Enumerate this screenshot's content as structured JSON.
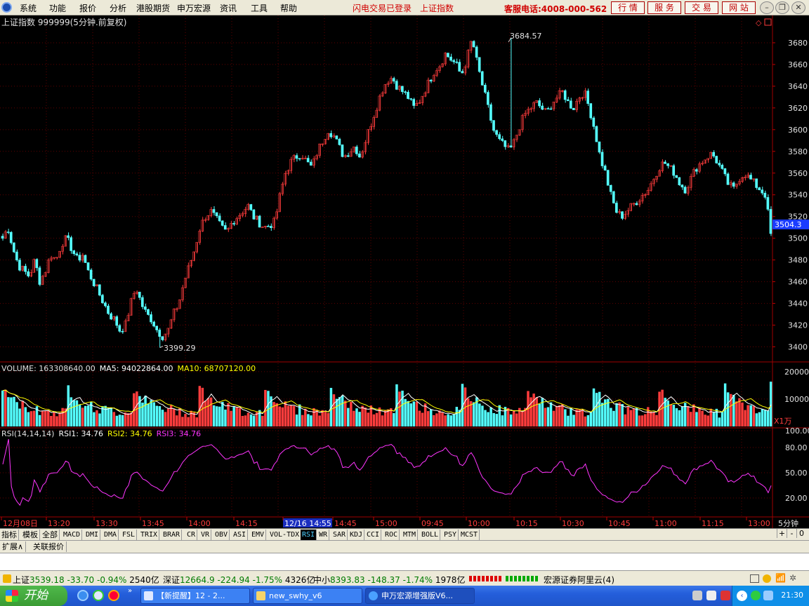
{
  "menu": {
    "items": [
      "系统",
      "功能",
      "报价",
      "分析",
      "港股期货",
      "申万宏源",
      "资讯",
      "工具",
      "帮助"
    ],
    "flash_login": "闪电交易已登录",
    "index_label": "上证指数",
    "hotline": "客服电话:4008-000-562",
    "nav_buttons": [
      "行 情",
      "服 务",
      "交 易",
      "网 站"
    ]
  },
  "chart": {
    "title": "上证指数 999999(5分钟.前复权)",
    "current_price_tag": "3504.3",
    "high_label": "3684.57",
    "low_label": "3399.29",
    "price_ticks": [
      "3680",
      "3660",
      "3640",
      "3620",
      "3600",
      "3580",
      "3560",
      "3540",
      "3520",
      "3500",
      "3480",
      "3460",
      "3440",
      "3420",
      "3400"
    ],
    "volume": {
      "label_prefix": "VOLUME: 163308640.00",
      "ma5": "MA5: 94022864.00",
      "ma10": "MA10: 68707120.00",
      "ticks": [
        "20000",
        "10000"
      ],
      "unit": "X1万"
    },
    "rsi": {
      "label": "RSI(14,14,14)",
      "rsi1": "RSI1: 34.76",
      "rsi2": "RSI2: 34.76",
      "rsi3": "RSI3: 34.76",
      "ticks": [
        "100.00",
        "80.00",
        "50.00",
        "20.00"
      ]
    },
    "time_axis": [
      "12月08日",
      "13:20",
      "13:30",
      "13:45",
      "14:00",
      "14:15",
      "12/16 14:55",
      "14:45",
      "15:00",
      "09:45",
      "10:00",
      "10:15",
      "10:30",
      "10:45",
      "11:00",
      "11:15",
      "13:00"
    ],
    "period": "5分钟"
  },
  "chart_data": {
    "type": "candlestick",
    "title": "上证指数 999999(5分钟.前复权)",
    "ylim": [
      3390,
      3700
    ],
    "high": 3684.57,
    "low": 3399.29,
    "last": 3504.3,
    "close_path": [
      3500,
      3510,
      3490,
      3475,
      3470,
      3465,
      3480,
      3460,
      3470,
      3485,
      3480,
      3495,
      3500,
      3490,
      3480,
      3485,
      3470,
      3460,
      3450,
      3440,
      3430,
      3425,
      3415,
      3420,
      3440,
      3455,
      3440,
      3430,
      3425,
      3415,
      3410,
      3415,
      3430,
      3440,
      3460,
      3475,
      3490,
      3510,
      3520,
      3525,
      3518,
      3510,
      3505,
      3515,
      3520,
      3525,
      3530,
      3520,
      3515,
      3510,
      3512,
      3515,
      3540,
      3560,
      3570,
      3575,
      3578,
      3570,
      3565,
      3580,
      3590,
      3600,
      3595,
      3585,
      3575,
      3580,
      3585,
      3575,
      3590,
      3605,
      3620,
      3635,
      3645,
      3648,
      3640,
      3635,
      3630,
      3620,
      3625,
      3635,
      3645,
      3655,
      3660,
      3670,
      3665,
      3660,
      3650,
      3665,
      3684,
      3660,
      3640,
      3620,
      3600,
      3590,
      3585,
      3580,
      3590,
      3605,
      3615,
      3620,
      3625,
      3620,
      3615,
      3625,
      3630,
      3635,
      3625,
      3620,
      3630,
      3635,
      3620,
      3600,
      3575,
      3560,
      3540,
      3525,
      3520,
      3525,
      3530,
      3535,
      3540,
      3545,
      3555,
      3565,
      3570,
      3565,
      3560,
      3550,
      3545,
      3555,
      3565,
      3570,
      3575,
      3578,
      3570,
      3560,
      3550,
      3545,
      3555,
      3560,
      3555,
      3550,
      3545,
      3540,
      3504
    ],
    "volume_ylim": [
      0,
      20000
    ],
    "rsi_ylim": [
      0,
      100
    ],
    "rsi_last": 34.76
  },
  "tabs": [
    "指标",
    "模板",
    "全部",
    "MACD",
    "DMI",
    "DMA",
    "FSL",
    "TRIX",
    "BRAR",
    "CR",
    "VR",
    "OBV",
    "ASI",
    "EMV",
    "VOL-TDX",
    "RSI",
    "WR",
    "SAR",
    "KDJ",
    "CCI",
    "ROC",
    "MTM",
    "BOLL",
    "PSY",
    "MCST"
  ],
  "tab_controls": [
    "+",
    "-",
    "0"
  ],
  "ext_tabs": [
    "扩展∧",
    "关联报价"
  ],
  "status": {
    "sh_label": "上证",
    "sh_value": "3539.18",
    "sh_change": "-33.70",
    "sh_pct": "-0.94%",
    "sh_amount": "2540亿",
    "sz_label": "深证",
    "sz_value": "12664.9",
    "sz_change": "-224.94",
    "sz_pct": "-1.75%",
    "sz_amount": "4326亿",
    "zx_label": "中小",
    "zx_value": "8393.83",
    "zx_change": "-148.37",
    "zx_pct": "-1.74%",
    "zx_amount": "1978亿",
    "broker": "宏源证券阿里云(4)"
  },
  "taskbar": {
    "start": "开始",
    "tasks": [
      "【新提醒】12 - 2...",
      "new_swhy_v6",
      "申万宏源增强版V6..."
    ],
    "clock": "21:30"
  },
  "colors": {
    "up": "#ff3c3c",
    "down": "#54ffff",
    "axis": "#c00000",
    "rsi": "#ff35ff",
    "ma5": "#ffffff",
    "ma10": "#ffff00"
  }
}
